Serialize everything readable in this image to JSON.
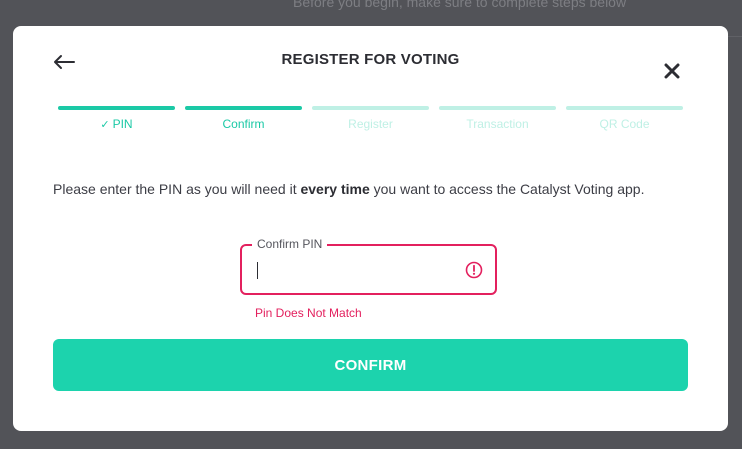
{
  "background": {
    "hint_text": "Before you begin, make sure to complete steps below"
  },
  "modal": {
    "title": "REGISTER FOR VOTING",
    "back_icon": "arrow-left-icon",
    "close_icon": "close-icon",
    "steps": [
      {
        "label": "PIN",
        "state": "done",
        "check": "✓"
      },
      {
        "label": "Confirm",
        "state": "active"
      },
      {
        "label": "Register",
        "state": "pending"
      },
      {
        "label": "Transaction",
        "state": "pending"
      },
      {
        "label": "QR Code",
        "state": "pending"
      }
    ],
    "instructions": {
      "before": "Please enter the PIN as you will need it ",
      "emphasis": "every time",
      "after": " you want to access the Catalyst Voting app."
    },
    "pin_field": {
      "label": "Confirm PIN",
      "value": "",
      "error": "Pin Does Not Match",
      "error_icon": "alert-circle-icon"
    },
    "confirm_button": "CONFIRM"
  },
  "colors": {
    "accent": "#1bc9a6",
    "accent_light": "#bff0e5",
    "button": "#1cd3ad",
    "error": "#e3205e",
    "overlay": "#525358"
  }
}
